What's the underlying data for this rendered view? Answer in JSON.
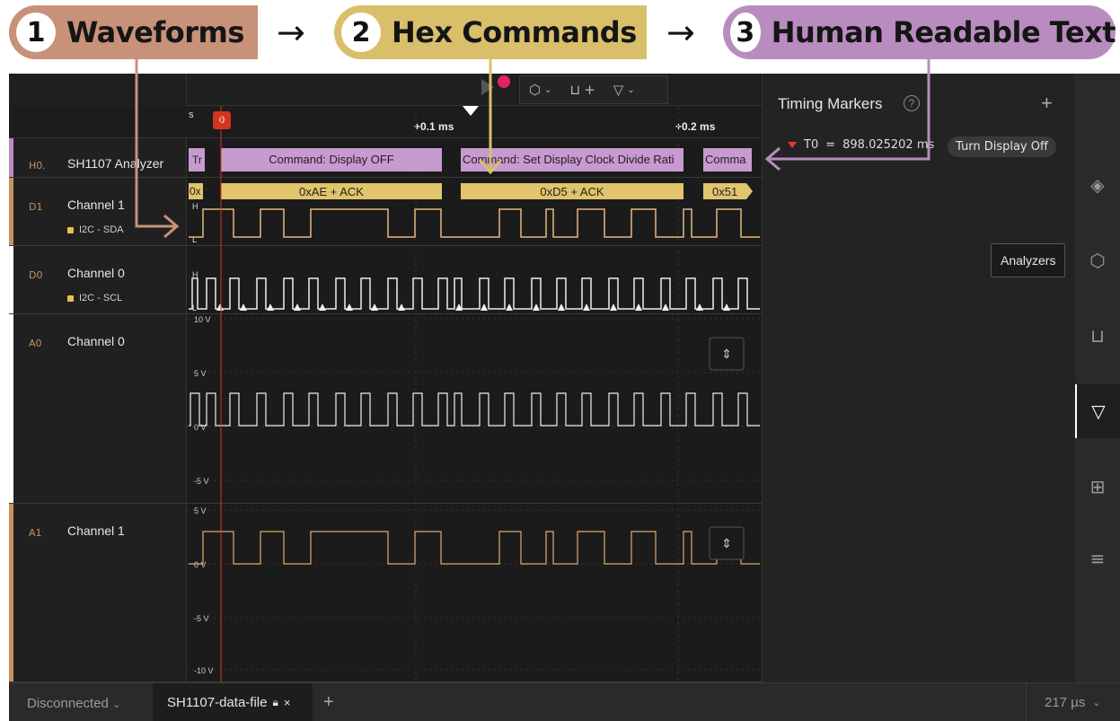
{
  "banner": {
    "steps": [
      {
        "num": "1",
        "label": "Waveforms"
      },
      {
        "num": "2",
        "label": "Hex Commands"
      },
      {
        "num": "3",
        "label": "Human Readable Text"
      }
    ],
    "arrow": "→"
  },
  "timebar": {
    "unit": "s",
    "ticks": [
      "+0.1 ms",
      "+0.2 ms"
    ],
    "marker": "0"
  },
  "rows": [
    {
      "tag": "H0.",
      "name": "SH1107 Analyzer",
      "sub": "",
      "stripe": "#b98cc0"
    },
    {
      "tag": "D1",
      "name": "Channel 1",
      "sub": "I2C - SDA",
      "stripe": "#c9915e"
    },
    {
      "tag": "D0",
      "name": "Channel 0",
      "sub": "I2C - SCL",
      "stripe": "#ffffff"
    },
    {
      "tag": "A0",
      "name": "Channel 0",
      "sub": "",
      "stripe": "#ffffff"
    },
    {
      "tag": "A1",
      "name": "Channel 1",
      "sub": "",
      "stripe": "#c9915e"
    }
  ],
  "decodes": {
    "analyzer": [
      "Tr",
      "Command: Display OFF",
      "Command: Set Display Clock Divide Rati",
      "Comma"
    ],
    "hex": [
      "0x",
      "0xAE + ACK",
      "0xD5 + ACK",
      "0x51"
    ]
  },
  "levels": {
    "high": "H",
    "low": "L"
  },
  "analog": {
    "a0": [
      "10 V",
      "5 V",
      "0 V",
      "-5 V"
    ],
    "a1": [
      "5 V",
      "0 V",
      "-5 V",
      "-10 V"
    ]
  },
  "right_panel": {
    "title": "Timing Markers",
    "help": "?",
    "add": "+",
    "marker_name": "T0",
    "marker_eq": "=",
    "marker_value": "898.025202 ms",
    "note": "Turn Display Off"
  },
  "tooltip": "Analyzers",
  "statusbar": {
    "connection": "Disconnected",
    "tab": "SH1107-data-file",
    "zoom": "217 µs"
  },
  "colors": {
    "analyzer_bubble": "#c79ad0",
    "hex_bubble": "#e2c46c",
    "sda_wave": "#e8b880",
    "digital_wave": "#f0f0f0",
    "a1_wave": "#e3a86b",
    "marker": "#e03a3a"
  }
}
